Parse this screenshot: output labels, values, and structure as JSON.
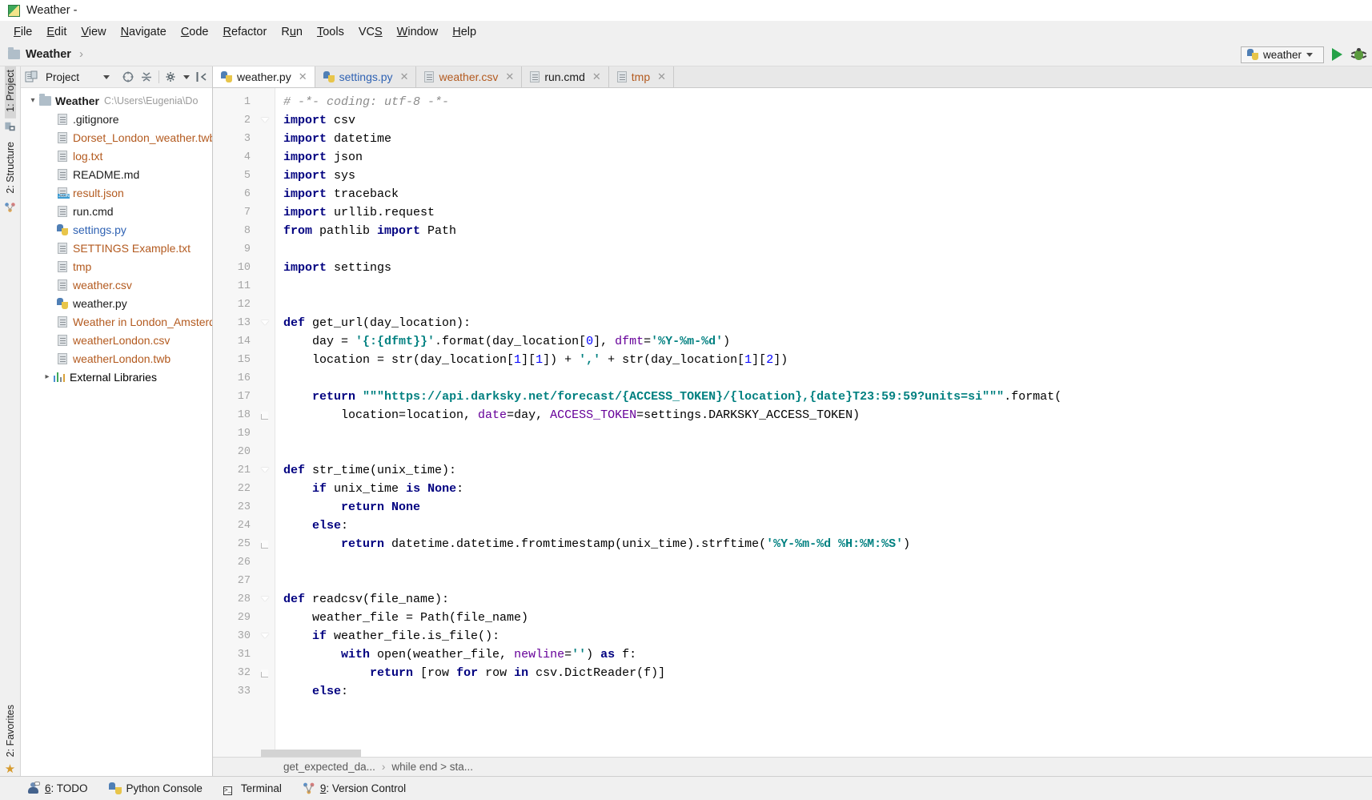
{
  "window": {
    "title": "Weather - ",
    "app_icon": "pycharm-icon"
  },
  "menubar": [
    {
      "label": "File",
      "mnemonic": "F"
    },
    {
      "label": "Edit",
      "mnemonic": "E"
    },
    {
      "label": "View",
      "mnemonic": "V"
    },
    {
      "label": "Navigate",
      "mnemonic": "N"
    },
    {
      "label": "Code",
      "mnemonic": "C"
    },
    {
      "label": "Refactor",
      "mnemonic": "R"
    },
    {
      "label": "Run",
      "mnemonic": "u"
    },
    {
      "label": "Tools",
      "mnemonic": "T"
    },
    {
      "label": "VCS",
      "mnemonic": "S"
    },
    {
      "label": "Window",
      "mnemonic": "W"
    },
    {
      "label": "Help",
      "mnemonic": "H"
    }
  ],
  "navbar": {
    "breadcrumb": "Weather",
    "separator": "›",
    "run_config": "weather",
    "run_button": "run-button",
    "debug_button": "debug-button"
  },
  "tool_strip": {
    "left_top": "1: Project",
    "left_middle": "2: Structure",
    "left_bottom": "2: Favorites"
  },
  "project_panel": {
    "toolbar_title": "Project",
    "root": {
      "label": "Weather",
      "path": "C:\\Users\\Eugenia\\Do"
    },
    "files": [
      {
        "name": ".gitignore",
        "icon": "file-icon",
        "color": "#1b1b1b"
      },
      {
        "name": "Dorset_London_weather.twb",
        "icon": "file-icon",
        "color": "#b35a1f"
      },
      {
        "name": "log.txt",
        "icon": "file-icon",
        "color": "#b35a1f"
      },
      {
        "name": "README.md",
        "icon": "file-icon",
        "color": "#1b1b1b"
      },
      {
        "name": "result.json",
        "icon": "json-file-icon",
        "color": "#b35a1f"
      },
      {
        "name": "run.cmd",
        "icon": "file-icon",
        "color": "#1b1b1b"
      },
      {
        "name": "settings.py",
        "icon": "python-file-icon",
        "color": "#2f62b3"
      },
      {
        "name": "SETTINGS Example.txt",
        "icon": "file-icon",
        "color": "#b35a1f"
      },
      {
        "name": "tmp",
        "icon": "file-icon",
        "color": "#b35a1f"
      },
      {
        "name": "weather.csv",
        "icon": "file-icon",
        "color": "#b35a1f"
      },
      {
        "name": "weather.py",
        "icon": "python-file-icon",
        "color": "#1b1b1b"
      },
      {
        "name": "Weather in London_Amsterd",
        "icon": "file-icon",
        "color": "#b35a1f"
      },
      {
        "name": "weatherLondon.csv",
        "icon": "file-icon",
        "color": "#b35a1f"
      },
      {
        "name": "weatherLondon.twb",
        "icon": "file-icon",
        "color": "#b35a1f"
      }
    ],
    "external_libraries": "External Libraries"
  },
  "editor_tabs": [
    {
      "label": "weather.py",
      "icon": "python-file-icon",
      "active": true,
      "color": "#1b1b1b"
    },
    {
      "label": "settings.py",
      "icon": "python-file-icon",
      "active": false,
      "color": "#2f62b3"
    },
    {
      "label": "weather.csv",
      "icon": "file-icon",
      "active": false,
      "color": "#b35a1f"
    },
    {
      "label": "run.cmd",
      "icon": "file-icon",
      "active": false,
      "color": "#1b1b1b"
    },
    {
      "label": "tmp",
      "icon": "file-icon",
      "active": false,
      "color": "#b35a1f"
    }
  ],
  "editor": {
    "first_line": 1,
    "line_numbers": [
      1,
      2,
      3,
      4,
      5,
      6,
      7,
      8,
      9,
      10,
      11,
      12,
      13,
      14,
      15,
      16,
      17,
      18,
      19,
      20,
      21,
      22,
      23,
      24,
      25,
      26,
      27,
      28,
      29,
      30,
      31,
      32,
      33
    ],
    "lines": [
      "# -*- coding: utf-8 -*-",
      "import csv",
      "import datetime",
      "import json",
      "import sys",
      "import traceback",
      "import urllib.request",
      "from pathlib import Path",
      "",
      "import settings",
      "",
      "",
      "def get_url(day_location):",
      "    day = '{:{dfmt}}'.format(day_location[0], dfmt='%Y-%m-%d')",
      "    location = str(day_location[1][1]) + ',' + str(day_location[1][2])",
      "",
      "    return \"\"\"https://api.darksky.net/forecast/{ACCESS_TOKEN}/{location},{date}T23:59:59?units=si\"\"\".format(",
      "        location=location, date=day, ACCESS_TOKEN=settings.DARKSKY_ACCESS_TOKEN)",
      "",
      "",
      "def str_time(unix_time):",
      "    if unix_time is None:",
      "        return None",
      "    else:",
      "        return datetime.datetime.fromtimestamp(unix_time).strftime('%Y-%m-%d %H:%M:%S')",
      "",
      "",
      "def readcsv(file_name):",
      "    weather_file = Path(file_name)",
      "    if weather_file.is_file():",
      "        with open(weather_file, newline='') as f:",
      "            return [row for row in csv.DictReader(f)]",
      "    else:"
    ]
  },
  "editor_breadcrumb": {
    "first": "get_expected_da...",
    "separator": "›",
    "second": "while end > sta..."
  },
  "statusbar": [
    {
      "label": "6: TODO",
      "mnemonic": "6",
      "icon": "todo-icon"
    },
    {
      "label": "Python Console",
      "mnemonic": "",
      "icon": "python-console-icon"
    },
    {
      "label": "Terminal",
      "mnemonic": "",
      "icon": "terminal-icon"
    },
    {
      "label": "9: Version Control",
      "mnemonic": "9",
      "icon": "version-control-icon"
    }
  ],
  "colors": {
    "keyword": "#000080",
    "string": "#008080",
    "comment": "#8c8c8c",
    "number": "#0000ff",
    "named_arg": "#660099",
    "accent_run": "#24a148",
    "file_orange": "#b35a1f",
    "file_blue": "#2f62b3"
  }
}
